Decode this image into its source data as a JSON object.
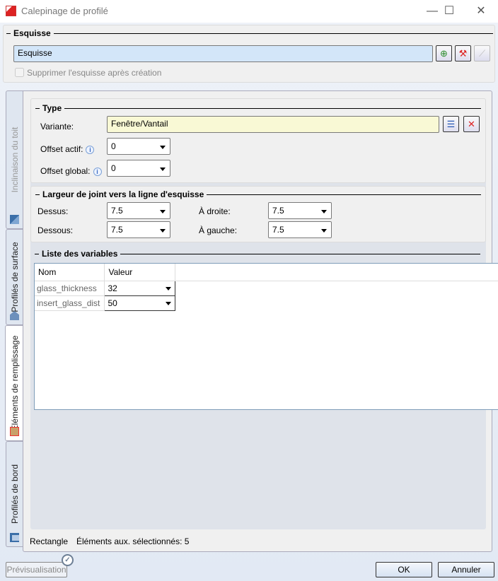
{
  "window": {
    "title": "Calepinage de profilé",
    "minimize": "—",
    "maximize": "☐",
    "close": "✕"
  },
  "sketch": {
    "group_title": "Esquisse",
    "field_value": "Esquisse",
    "delete_checkbox_label": "Supprimer l'esquisse après création",
    "delete_checked": false
  },
  "tabs": [
    {
      "label": "Inclinaison du toit",
      "icon": "roof-icon"
    },
    {
      "label": "Profilés de surface",
      "icon": "surface-profile-icon"
    },
    {
      "label": "Éléments de remplissage",
      "icon": "fill-element-icon",
      "active": true
    },
    {
      "label": "Profilés de bord",
      "icon": "edge-profile-icon"
    }
  ],
  "type": {
    "title": "Type",
    "variant_label": "Variante:",
    "variant_value": "Fenêtre/Vantail",
    "offset_active_label": "Offset actif:",
    "offset_active_value": "0",
    "offset_global_label": "Offset global:",
    "offset_global_value": "0"
  },
  "joint": {
    "title": "Largeur de joint vers la ligne d'esquisse",
    "top_label": "Dessus:",
    "top_value": "7.5",
    "bottom_label": "Dessous:",
    "bottom_value": "7.5",
    "right_label": "À droite:",
    "right_value": "7.5",
    "left_label": "À gauche:",
    "left_value": "7.5"
  },
  "variables": {
    "title": "Liste des variables",
    "columns": [
      "Nom",
      "Valeur"
    ],
    "rows": [
      {
        "name": "glass_thickness",
        "value": "32"
      },
      {
        "name": "insert_glass_dist",
        "value": "50"
      }
    ]
  },
  "status": {
    "shape": "Rectangle",
    "selected": "Éléments aux. sélectionnés: 5"
  },
  "footer": {
    "preview": "Prévisualisation",
    "ok": "OK",
    "cancel": "Annuler"
  }
}
